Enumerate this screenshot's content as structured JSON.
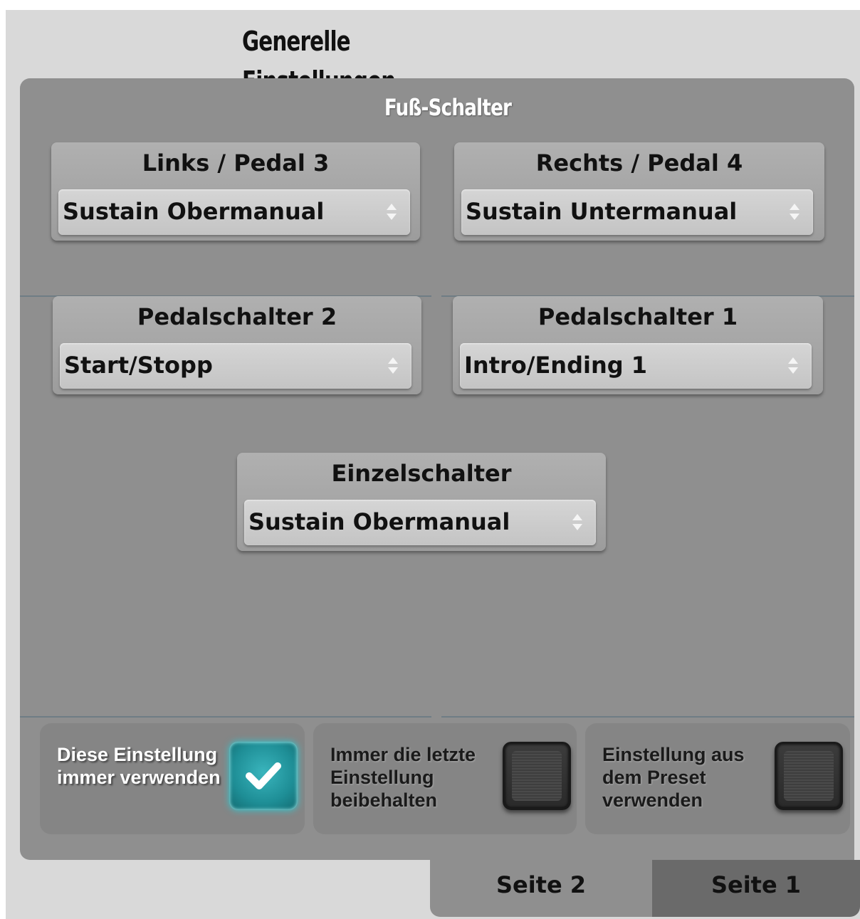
{
  "header": {
    "title": "Generelle Einstellungen"
  },
  "section": {
    "title": "Fuß-Schalter"
  },
  "switches": [
    {
      "label": "Links / Pedal 3",
      "value": "Sustain Obermanual"
    },
    {
      "label": "Rechts  / Pedal 4",
      "value": "Sustain Untermanual"
    },
    {
      "label": "Pedalschalter 2",
      "value": "Start/Stopp"
    },
    {
      "label": "Pedalschalter 1",
      "value": "Intro/Ending 1"
    },
    {
      "label": "Einzelschalter",
      "value": "Sustain Obermanual"
    }
  ],
  "options": [
    {
      "label": "Diese Einstellung immer verwenden",
      "checked": true
    },
    {
      "label": "Immer die letzte Einstellung beibehalten",
      "checked": false
    },
    {
      "label": "Einstellung aus dem Preset verwenden",
      "checked": false
    }
  ],
  "tabs": [
    {
      "label": "Seite 2",
      "active": true
    },
    {
      "label": "Seite 1",
      "active": false
    }
  ],
  "colors": {
    "accent": "#1e8e96",
    "panel": "#8f8f8f"
  }
}
